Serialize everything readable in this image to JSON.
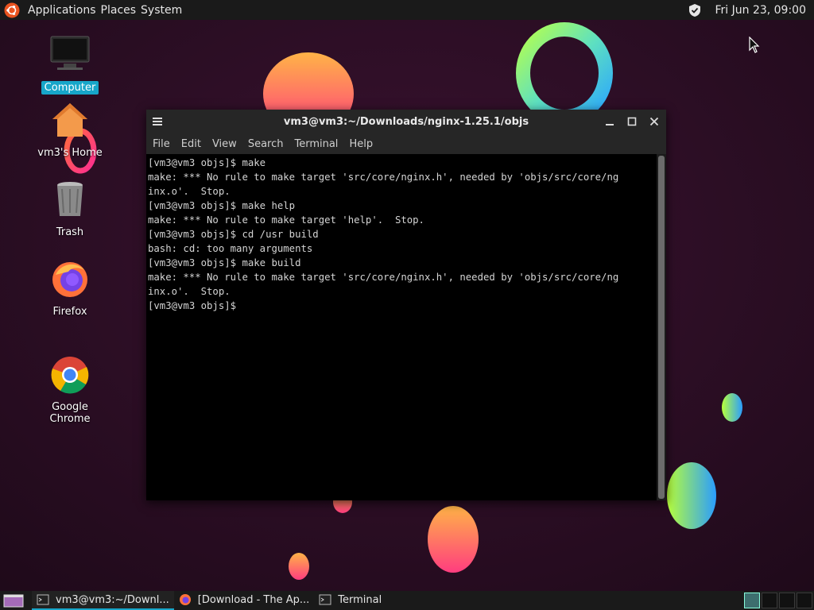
{
  "top_panel": {
    "menus": [
      "Applications",
      "Places",
      "System"
    ],
    "clock": "Fri Jun 23, 09:00"
  },
  "desktop": {
    "icons": [
      {
        "label": "Computer",
        "icon": "computer-icon",
        "selected": true
      },
      {
        "label": "vm3's Home",
        "icon": "home-folder-icon",
        "selected": false
      },
      {
        "label": "Trash",
        "icon": "trash-icon",
        "selected": false
      },
      {
        "label": "Firefox",
        "icon": "firefox-icon",
        "selected": false
      },
      {
        "label": "Google Chrome",
        "icon": "chrome-icon",
        "selected": false
      }
    ]
  },
  "terminal": {
    "title": "vm3@vm3:~/Downloads/nginx-1.25.1/objs",
    "menu": [
      "File",
      "Edit",
      "View",
      "Search",
      "Terminal",
      "Help"
    ],
    "lines": [
      "[vm3@vm3 objs]$ make",
      "make: *** No rule to make target 'src/core/nginx.h', needed by 'objs/src/core/ng",
      "inx.o'.  Stop.",
      "[vm3@vm3 objs]$ make help",
      "make: *** No rule to make target 'help'.  Stop.",
      "[vm3@vm3 objs]$ cd /usr build",
      "bash: cd: too many arguments",
      "[vm3@vm3 objs]$ make build",
      "make: *** No rule to make target 'src/core/nginx.h', needed by 'objs/src/core/ng",
      "inx.o'.  Stop.",
      "[vm3@vm3 objs]$"
    ]
  },
  "taskbar": {
    "tasks": [
      {
        "label": "vm3@vm3:~/Downl...",
        "icon": "terminal-icon",
        "active": true
      },
      {
        "label": "[Download - The Ap...",
        "icon": "firefox-icon",
        "active": false
      },
      {
        "label": "Terminal",
        "icon": "terminal-icon",
        "active": false
      }
    ],
    "workspace_count": 4,
    "active_workspace": 1
  },
  "colors": {
    "accent": "#17a6c9",
    "panel": "#1a1a1a",
    "wallpaper": "#2c0f24"
  }
}
